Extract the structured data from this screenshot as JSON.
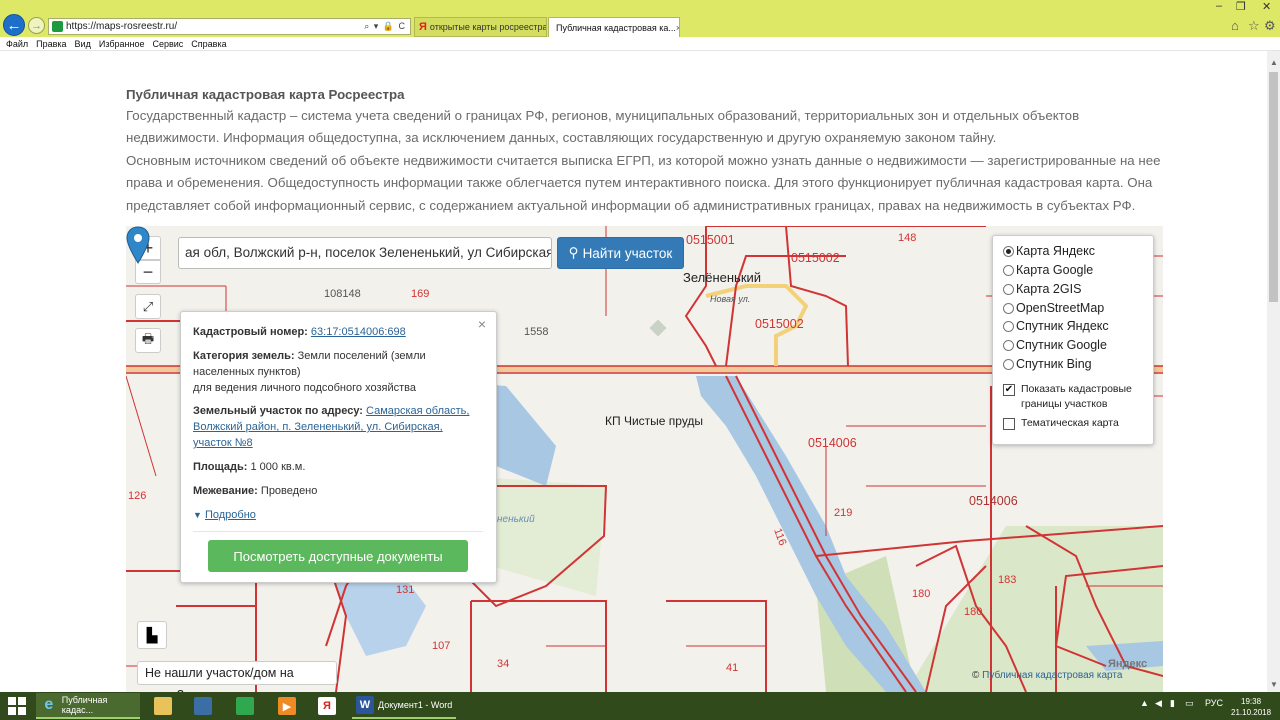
{
  "browser": {
    "url": "https://maps-rosreestr.ru/",
    "address_tools": "⌕ ▾ 🔒 C",
    "tabs": [
      {
        "label": "открытые карты росреестра ..."
      },
      {
        "label": "Публичная кадастровая ка...",
        "close": "×"
      }
    ],
    "menu": [
      "Файл",
      "Правка",
      "Вид",
      "Избранное",
      "Сервис",
      "Справка"
    ]
  },
  "page": {
    "intro_title": "Публичная кадастровая карта Росреестра",
    "intro_p1": "Государственный кадастр – система учета сведений о границах РФ, регионов, муниципальных образований, территориальных зон и отдельных объектов недвижимости. Информация общедоступна, за исключением данных, составляющих государственную и другую охраняемую законом тайну.",
    "intro_p2": "Основным источником сведений об объекте недвижимости считается выписка ЕГРП, из которой можно узнать данные о недвижимости — зарегистрированные на нее права и обременения. Общедоступность информации также облегчается путем интерактивного поиска. Для этого функционирует публичная кадастровая карта. Она представляет собой информационный сервис, с содержанием актуальной информации об административных границах, правах на недвижимость в субъектах РФ."
  },
  "map": {
    "zoom_in": "+",
    "zoom_out": "−",
    "search_value": "ая обл, Волжский р-н, поселок Зелененький, ул Сибирская",
    "search_button": "Найти участок",
    "popup": {
      "close": "×",
      "cad_label": "Кадастровый номер:",
      "cad_value": "63:17:0514006:698",
      "cat_label": "Категория земель:",
      "cat_value": "Земли поселений (земли населенных пунктов)",
      "use_value": "для ведения личного подсобного хозяйства",
      "addr_label": "Земельный участок по адресу:",
      "addr_value": "Самарская область, Волжский район, п. Зелененький, ул. Сибирская, участок №8",
      "area_label": "Площадь:",
      "area_value": "1 000 кв.м.",
      "survey_label": "Межевание:",
      "survey_value": "Проведено",
      "more": "Подробно",
      "docs_button": "Посмотреть доступные документы"
    },
    "layers": {
      "options": [
        {
          "label": "Карта Яндекс",
          "selected": true
        },
        {
          "label": "Карта Google",
          "selected": false
        },
        {
          "label": "Карта 2GIS",
          "selected": false
        },
        {
          "label": "OpenStreetMap",
          "selected": false
        },
        {
          "label": "Спутник Яндекс",
          "selected": false
        },
        {
          "label": "Спутник Google",
          "selected": false
        },
        {
          "label": "Спутник Bing",
          "selected": false
        }
      ],
      "show_borders": "Показать кадастровые границы участков",
      "show_borders_checked": "✔",
      "thematic": "Тематическая карта"
    },
    "labels": {
      "l148": "148",
      "l0515001": "0515001",
      "l0515002a": "0515002",
      "l0515002b": "0515002",
      "zelen": "Зелёненький",
      "novaya": "Новая ул.",
      "l108148": "108148",
      "l169": "169",
      "l1558": "1558",
      "kp": "КП Чистые пруды",
      "l0514006a": "0514006",
      "l0514006b": "0514006",
      "l126": "126",
      "l219": "219",
      "l116": "116",
      "l180a": "180",
      "l180b": "180",
      "l183": "183",
      "l131": "131",
      "l107": "107",
      "l34": "34",
      "l41": "41",
      "river": "ненький"
    },
    "not_found": "Не нашли участок/дом на карте?",
    "copyright_symbol": "©",
    "copyright": "Публичная кадастровая карта",
    "yandex": "Яндекс"
  },
  "taskbar": {
    "ie_label": "Публичная кадас...",
    "word_label": "Документ1 - Word",
    "lang": "РУС",
    "time": "19:38",
    "date": "21.10.2018"
  },
  "colors": {
    "parcel_border": "#d13434",
    "water": "#a7c7e3",
    "forest": "#cfe0b8",
    "primary_button": "#337ab7",
    "success_button": "#5cb85c"
  }
}
